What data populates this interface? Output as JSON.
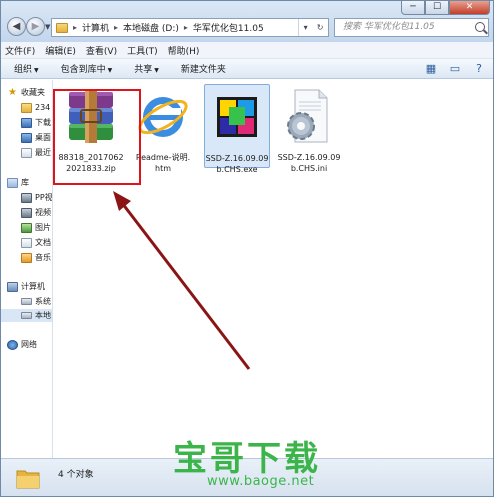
{
  "window": {
    "controls": {
      "minimize": "─",
      "maximize": "☐",
      "close": "✕"
    }
  },
  "address": {
    "crumbs": [
      "计算机",
      "本地磁盘 (D:)",
      "华军优化包11.05"
    ],
    "separator": "▸",
    "refresh": "↻"
  },
  "search": {
    "placeholder": "搜索 华军优化包11.05"
  },
  "menu": [
    "文件(F)",
    "编辑(E)",
    "查看(V)",
    "工具(T)",
    "帮助(H)"
  ],
  "toolbar": {
    "organize": "组织",
    "include_library": "包含到库中",
    "share": "共享",
    "new_folder": "新建文件夹"
  },
  "navpane": {
    "favorites": "收藏夹",
    "fav_items": [
      "234",
      "下载",
      "桌面",
      "最近"
    ],
    "libraries": "库",
    "lib_items": [
      "PP视",
      "视频",
      "图片",
      "文档",
      "音乐"
    ],
    "computer": "计算机",
    "comp_items": [
      "系统",
      "本地"
    ],
    "network": "网络"
  },
  "files": [
    {
      "name": "88318_20170622021833.zip",
      "line1": "88318_2017062",
      "line2": "2021833.zip",
      "icon": "winrar-archive-icon"
    },
    {
      "name": "Readme-说明.htm",
      "line1": "Readme-说明.",
      "line2": "htm",
      "icon": "internet-explorer-icon"
    },
    {
      "name": "SSD-Z.16.09.09b.CHS.exe",
      "line1": "SSD-Z.16.09.09",
      "line2": "b.CHS.exe",
      "icon": "ssd-z-app-icon"
    },
    {
      "name": "SSD-Z.16.09.09b.CHS.ini",
      "line1": "SSD-Z.16.09.09",
      "line2": "b.CHS.ini",
      "icon": "ini-settings-file-icon"
    }
  ],
  "status": {
    "text": "4 个对象"
  },
  "watermark": {
    "main": "宝哥下载",
    "url": "www.baoge.net"
  },
  "colors": {
    "highlight": "#e0121b",
    "arrow": "#8b1414",
    "watermark": "#3bb54a"
  }
}
